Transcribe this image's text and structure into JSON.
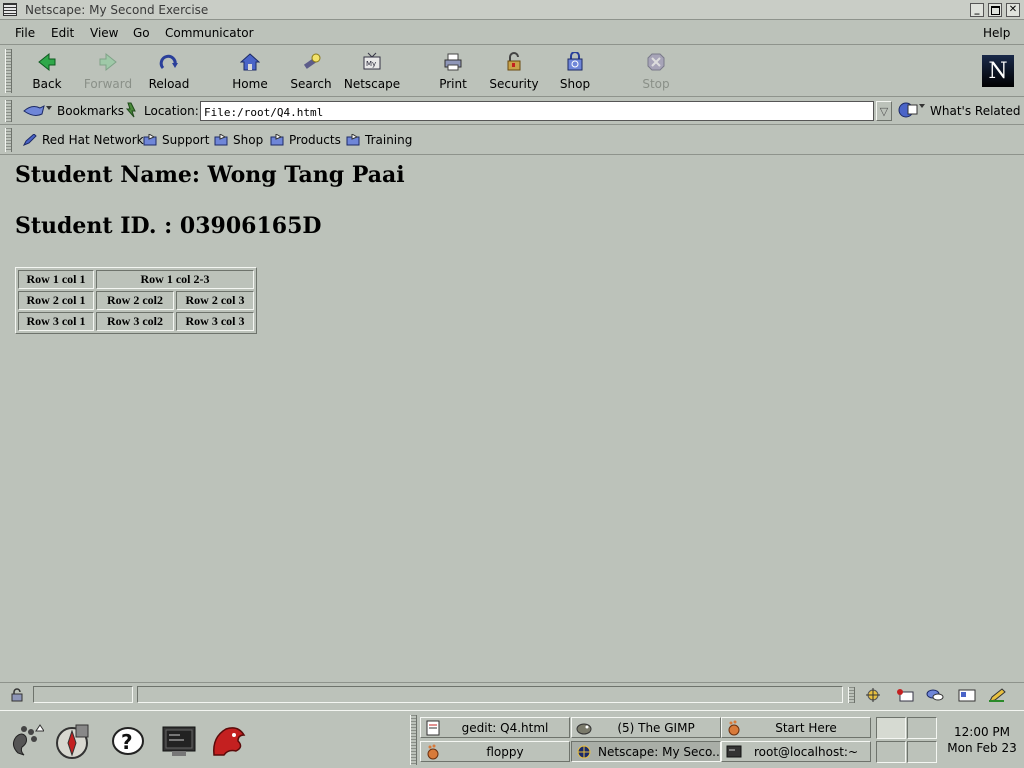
{
  "window": {
    "title": "Netscape: My Second Exercise"
  },
  "menu": {
    "items": [
      "File",
      "Edit",
      "View",
      "Go",
      "Communicator"
    ],
    "help": "Help"
  },
  "toolbar": {
    "back": "Back",
    "forward": "Forward",
    "reload": "Reload",
    "home": "Home",
    "search": "Search",
    "netscape": "Netscape",
    "print": "Print",
    "security": "Security",
    "shop": "Shop",
    "stop": "Stop"
  },
  "location_bar": {
    "bookmarks": "Bookmarks",
    "location_label": "Location:",
    "url": "File:/root/Q4.html",
    "whats_related": "What's Related"
  },
  "personal_toolbar": {
    "items": [
      "Red Hat Network",
      "Support",
      "Shop",
      "Products",
      "Training"
    ]
  },
  "page": {
    "student_name": "Student Name: Wong Tang Paai",
    "student_id": "Student ID. : 03906165D",
    "table": [
      [
        "Row 1 col 1",
        "Row 1 col 2-3"
      ],
      [
        "Row 2 col 1",
        "Row 2 col2",
        "Row 2 col 3"
      ],
      [
        "Row 3 col 1",
        "Row 3 col2",
        "Row 3 col 3"
      ]
    ]
  },
  "taskbar": {
    "tasks": [
      "gedit: Q4.html",
      "(5) The GIMP",
      "Start Here",
      "floppy",
      "Netscape: My Seco...",
      "root@localhost:~"
    ],
    "clock_time": "12:00 PM",
    "clock_date": "Mon Feb 23"
  },
  "colors": {
    "window_bg": "#bcc2ba",
    "logo_bg": "#1a2a4a"
  },
  "icons": {
    "toolbar": [
      "back-arrow",
      "forward-arrow",
      "reload",
      "home",
      "search-flashlight",
      "my-netscape",
      "printer",
      "security-lock",
      "shopping-bag",
      "stop-sign"
    ],
    "launchers": [
      "gnome-foot",
      "compass",
      "help",
      "terminal",
      "mozilla"
    ]
  }
}
